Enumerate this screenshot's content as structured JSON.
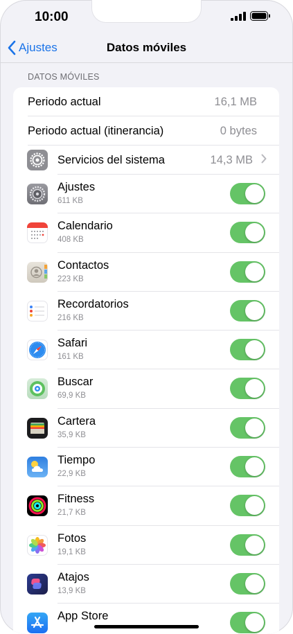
{
  "status": {
    "time": "10:00"
  },
  "nav": {
    "back_label": "Ajustes",
    "title": "Datos móviles"
  },
  "section": {
    "header": "DATOS MÓVILES"
  },
  "summary": [
    {
      "label": "Periodo actual",
      "value": "16,1 MB"
    },
    {
      "label": "Periodo actual (itinerancia)",
      "value": "0 bytes"
    }
  ],
  "system": {
    "label": "Servicios del sistema",
    "value": "14,3 MB",
    "icon": "gear-icon"
  },
  "apps": [
    {
      "name": "Ajustes",
      "size": "611 KB",
      "icon": "settings-icon",
      "enabled": true
    },
    {
      "name": "Calendario",
      "size": "408 KB",
      "icon": "calendar-icon",
      "enabled": true
    },
    {
      "name": "Contactos",
      "size": "223 KB",
      "icon": "contacts-icon",
      "enabled": true
    },
    {
      "name": "Recordatorios",
      "size": "216 KB",
      "icon": "reminders-icon",
      "enabled": true
    },
    {
      "name": "Safari",
      "size": "161 KB",
      "icon": "safari-icon",
      "enabled": true
    },
    {
      "name": "Buscar",
      "size": "69,9 KB",
      "icon": "find-my-icon",
      "enabled": true
    },
    {
      "name": "Cartera",
      "size": "35,9 KB",
      "icon": "wallet-icon",
      "enabled": true
    },
    {
      "name": "Tiempo",
      "size": "22,9 KB",
      "icon": "weather-icon",
      "enabled": true
    },
    {
      "name": "Fitness",
      "size": "21,7 KB",
      "icon": "fitness-icon",
      "enabled": true
    },
    {
      "name": "Fotos",
      "size": "19,1 KB",
      "icon": "photos-icon",
      "enabled": true
    },
    {
      "name": "Atajos",
      "size": "13,9 KB",
      "icon": "shortcuts-icon",
      "enabled": true
    },
    {
      "name": "App Store",
      "size": "",
      "icon": "app-store-icon",
      "enabled": true
    }
  ],
  "colors": {
    "accent": "#1a73e8",
    "toggle_on": "#65c466",
    "background": "#f2f2f7"
  }
}
